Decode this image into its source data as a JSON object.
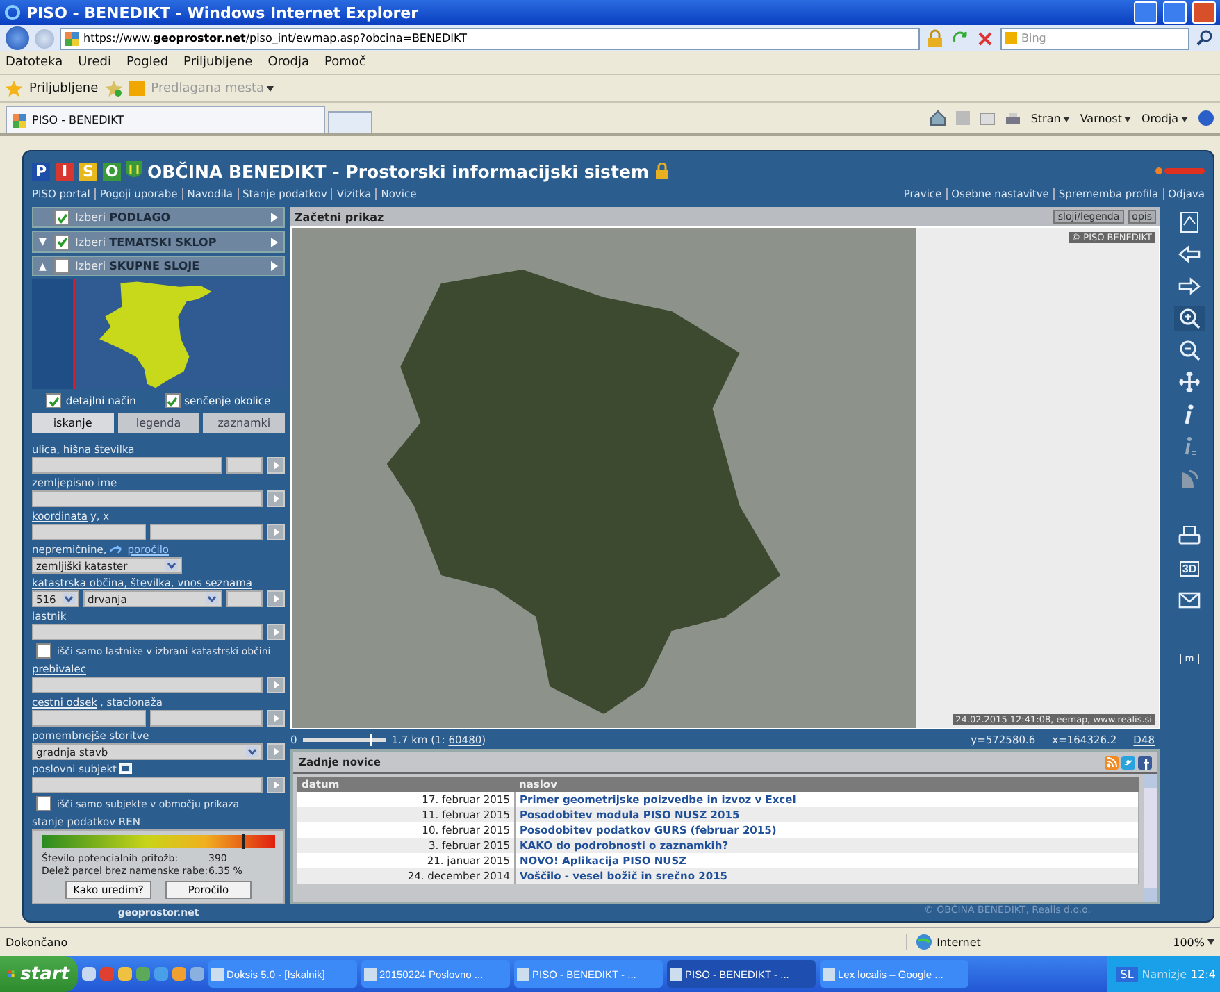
{
  "window": {
    "title": "PISO - BENEDIKT - Windows Internet Explorer"
  },
  "address_bar": {
    "url": "https://www.**geoprostor.net**/piso_int/ewmap.asp?obcina=BENEDIKT",
    "search_placeholder": "Bing"
  },
  "menu": [
    "Datoteka",
    "Uredi",
    "Pogled",
    "Priljubljene",
    "Orodja",
    "Pomoč"
  ],
  "favorites_bar": {
    "favorites": "Priljubljene",
    "suggested": "Predlagana mesta"
  },
  "tabs": [
    {
      "label": "PISO - BENEDIKT",
      "selected": true
    }
  ],
  "command_bar": [
    "Stran",
    "Varnost",
    "Orodja"
  ],
  "app": {
    "logo": [
      "P",
      "I",
      "S",
      "O"
    ],
    "title": "OBČINA BENEDIKT - Prostorski informacijski sistem",
    "nav_left": [
      "PISO portal",
      "Pogoji uporabe",
      "Navodila",
      "Stanje podatkov",
      "Vizitka",
      "Novice"
    ],
    "nav_right": [
      "Pravice",
      "Osebne nastavitve",
      "Sprememba profila",
      "Odjava"
    ],
    "layers": [
      {
        "prefix": "Izberi",
        "name": "PODLAGO",
        "checked": true
      },
      {
        "toggle": "▼",
        "prefix": "Izberi",
        "name": "TEMATSKI SKLOP",
        "checked": true
      },
      {
        "toggle": "▲",
        "prefix": "Izberi",
        "name": "SKUPNE SLOJE",
        "checked": false
      }
    ],
    "overview_options": [
      {
        "label": "detajlni način",
        "checked": true
      },
      {
        "label": "senčenje okolice",
        "checked": true
      }
    ],
    "panel_tabs": [
      {
        "label": "iskanje",
        "selected": true
      },
      {
        "label": "legenda",
        "selected": false
      },
      {
        "label": "zaznamki",
        "selected": false
      }
    ],
    "search": [
      {
        "kind": "field",
        "label": [
          {
            "kind": "plain",
            "text": "ulica, hišna številka"
          }
        ],
        "icon": false,
        "button": true,
        "inputs": [
          {
            "kind": "text"
          },
          {
            "kind": "short_text"
          }
        ]
      },
      {
        "kind": "field",
        "label": [
          {
            "kind": "plain",
            "text": "zemljepisno ime"
          }
        ],
        "icon": false,
        "button": true,
        "inputs": [
          {
            "kind": "text"
          }
        ]
      },
      {
        "kind": "field",
        "label": [
          {
            "kind": "link",
            "text": "koordinata"
          },
          {
            "kind": "plain",
            "text": " y, x"
          }
        ],
        "icon": false,
        "button": true,
        "inputs": [
          {
            "kind": "text"
          },
          {
            "kind": "text"
          }
        ]
      },
      {
        "kind": "field",
        "label": [
          {
            "kind": "plain",
            "text": "nepremičnine, "
          },
          {
            "kind": "arrow_link",
            "text": "poročilo"
          }
        ],
        "icon": false,
        "button": false,
        "inputs": [
          {
            "kind": "medium_select",
            "value": "zemljiški kataster"
          }
        ]
      },
      {
        "kind": "field",
        "label": [
          {
            "kind": "link",
            "text": "katastrska občina, številka, vnos seznama"
          }
        ],
        "icon": false,
        "button": true,
        "inputs": [
          {
            "kind": "short_select",
            "value": "516"
          },
          {
            "kind": "select",
            "value": "drvanja"
          },
          {
            "kind": "short_text"
          }
        ]
      },
      {
        "kind": "field",
        "label": [
          {
            "kind": "plain",
            "text": "lastnik"
          }
        ],
        "icon": false,
        "button": true,
        "inputs": [
          {
            "kind": "text"
          }
        ]
      },
      {
        "kind": "checkbox",
        "label": "išči samo lastnike v izbrani katastrski občini",
        "checked": false
      },
      {
        "kind": "field",
        "label": [
          {
            "kind": "link",
            "text": "prebivalec"
          }
        ],
        "icon": false,
        "button": true,
        "inputs": [
          {
            "kind": "text"
          }
        ]
      },
      {
        "kind": "field",
        "label": [
          {
            "kind": "link",
            "text": "cestni odsek"
          },
          {
            "kind": "plain",
            "text": ", stacionaža"
          }
        ],
        "icon": false,
        "button": true,
        "inputs": [
          {
            "kind": "text"
          },
          {
            "kind": "text"
          }
        ]
      },
      {
        "kind": "field",
        "label": [
          {
            "kind": "plain",
            "text": "pomembnejše storitve"
          }
        ],
        "icon": false,
        "button": true,
        "inputs": [
          {
            "kind": "select",
            "value": "gradnja stavb"
          }
        ]
      },
      {
        "kind": "field",
        "label": [
          {
            "kind": "plain",
            "text": "poslovni subjekt"
          }
        ],
        "icon": true,
        "button": true,
        "inputs": [
          {
            "kind": "text"
          }
        ]
      },
      {
        "kind": "checkbox",
        "label": "išči samo subjekte v območju prikaza",
        "checked": false
      }
    ],
    "ren": {
      "label": "stanje podatkov REN",
      "level": 0.86,
      "stats": [
        {
          "label": "Število potencialnih pritožb:",
          "value": "390"
        },
        {
          "label": "Delež parcel brez namenske rabe:",
          "value": "6.35 %"
        }
      ],
      "buttons": [
        "Kako uredim?",
        "Poročilo"
      ]
    },
    "panel_logo": "geoprostor.net",
    "map": {
      "title": "Začetni prikaz",
      "buttons": [
        "sloji/legenda",
        "opis"
      ],
      "copyright": "© PISO BENEDIKT",
      "stamp": "24.02.2015 12:41:08, eemap, www.realis.si"
    },
    "scale": {
      "zero": "0",
      "level": 0.8,
      "text": "1.7 km (1: ",
      "ratio": "60480",
      "close": ")"
    },
    "coordinates": {
      "y": "y=572580.6",
      "x": "x=164326.2",
      "link": "D48"
    },
    "tools": [
      {
        "kind": "overview",
        "selected": false
      },
      {
        "kind": "back",
        "selected": false
      },
      {
        "kind": "forward",
        "selected": false
      },
      {
        "kind": "zoom_in",
        "selected": true
      },
      {
        "kind": "zoom_out",
        "selected": false
      },
      {
        "kind": "pan",
        "selected": false
      },
      {
        "kind": "info",
        "selected": false
      },
      {
        "kind": "info_layer",
        "selected": false
      },
      {
        "kind": "satellite",
        "selected": false
      }
    ],
    "tools_lower": [
      {
        "kind": "print",
        "selected": false
      },
      {
        "kind": "three_d",
        "text": "3D",
        "selected": false
      },
      {
        "kind": "mail",
        "selected": false
      }
    ],
    "tools_bottom": [
      {
        "kind": "measure",
        "text": "m",
        "selected": false
      }
    ],
    "news": {
      "title": "Zadnje novice",
      "columns": [
        "datum",
        "naslov"
      ],
      "rows": [
        {
          "date": "17. februar 2015",
          "title": "Primer geometrijske poizvedbe in izvoz v Excel"
        },
        {
          "date": "11. februar 2015",
          "title": "Posodobitev modula PISO NUSZ 2015"
        },
        {
          "date": "10. februar 2015",
          "title": "Posodobitev podatkov GURS (februar 2015)"
        },
        {
          "date": "3. februar 2015",
          "title": "KAKO do podrobnosti o zaznamkih?"
        },
        {
          "date": "21. januar 2015",
          "title": "NOVO! Aplikacija PISO NUSZ"
        },
        {
          "date": "24. december 2014",
          "title": "Voščilo - vesel božič in srečno 2015"
        }
      ]
    },
    "copyright": "© OBČINA BENEDIKT, Realis d.o.o."
  },
  "status_bar": {
    "text": "Dokončano",
    "zone": "Internet",
    "zoom": "100%"
  },
  "taskbar": {
    "start": "start",
    "tasks": [
      {
        "label": "Doksis 5.0 - [Iskalnik]",
        "selected": false
      },
      {
        "label": "20150224 Poslovno ...",
        "selected": false
      },
      {
        "label": "PISO - BENEDIKT - ...",
        "selected": false
      },
      {
        "label": "PISO - BENEDIKT - ...",
        "selected": true
      },
      {
        "label": "Lex localis – Google ...",
        "selected": false
      }
    ],
    "language": "SL",
    "desktop": "Namizje",
    "clock": "12:4"
  }
}
